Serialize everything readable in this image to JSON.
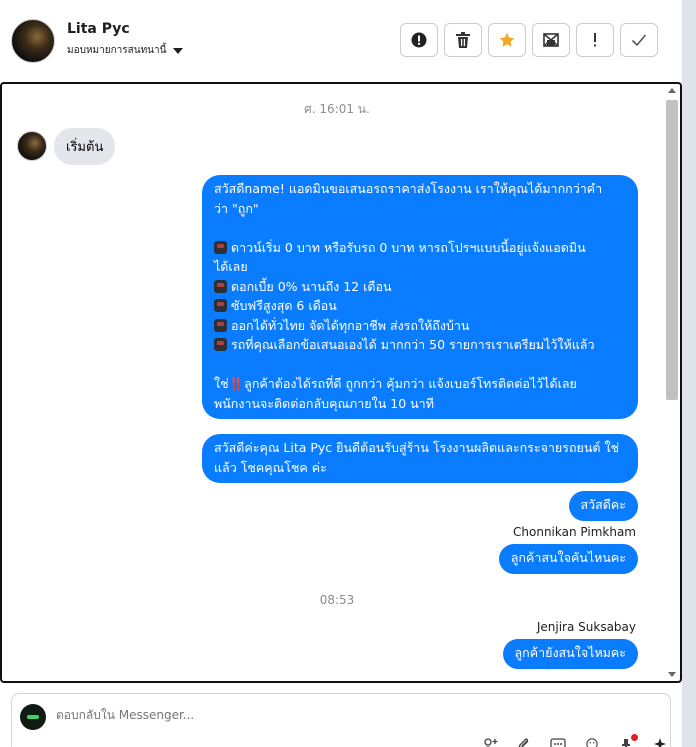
{
  "header": {
    "contact_name": "Lita Pyc",
    "assign_label": "มอบหมายการสนทนานี้",
    "actions": [
      {
        "name": "report-spam",
        "icon": "alert-circle-icon"
      },
      {
        "name": "delete",
        "icon": "trash-icon"
      },
      {
        "name": "star",
        "icon": "star-icon",
        "color": "#f5a623"
      },
      {
        "name": "mark-unread",
        "icon": "envelope-icon"
      },
      {
        "name": "follow-up",
        "icon": "exclamation-icon"
      },
      {
        "name": "done",
        "icon": "check-icon"
      }
    ]
  },
  "thread": {
    "timestamp_1": "ศ. 16:01 น.",
    "incoming_message": "เริ่มต้น",
    "main_message": {
      "line_1": "สวัสดีname! แอดมินขอเสนอรถราคาส่งโรงงาน เราให้คุณได้มากกว่าคำ",
      "line_2": "ว่า \"ถูก\"",
      "bullet_1a": "ดาวน์เริ่ม 0 บาท หรือรับรถ 0 บาท หารถโปรฯแบบนี้อยู่แจ้งแอดมิน",
      "bullet_1b": "ได้เลย",
      "bullet_2": "ดอกเบี้ย 0% นานถึง 12 เดือน",
      "bullet_3": "ซับฟรีสูงสุด 6 เดือน",
      "bullet_4": "ออกได้ทั่วไทย จัดได้ทุกอาชีพ ส่งรถให้ถึงบ้าน",
      "bullet_5": "รถที่คุณเลือกข้อเสนอเองได้ มากกว่า 50 รายการเราเตรียมไว้ให้แล้ว",
      "closing_prefix": "ใช่",
      "closing_bang": "‼️",
      "closing_1": "ลูกค้าต้องได้รถที่ดี ถูกกว่า คุ้มกว่า แจ้งเบอร์โทรติดต่อไว้ได้เลย",
      "closing_2": "พนักงานจะติดต่อกลับคุณภายใน 10 นาที"
    },
    "message_2": "สวัสดีค่ะคุณ Lita Pyc ยินดีต้อนรับสู่ร้าน โรงงานผลิตและกระจายรถยนต์ ใช่แล้ว โชคคุณโชค ค่ะ",
    "message_3": "สวัสดีคะ",
    "sender_1": "Chonnikan Pimkham",
    "message_4": "ลูกค้าสนใจคันไหนคะ",
    "timestamp_2": "08:53",
    "sender_2": "Jenjira Suksabay",
    "message_5": "ลูกค้ายังสนใจไหมคะ"
  },
  "composer": {
    "placeholder": "ตอบกลับใน Messenger...",
    "tools": [
      "add-person-icon",
      "paperclip-icon",
      "template-icon",
      "emoji-icon",
      "pin-icon",
      "sparkle-icon"
    ]
  },
  "colors": {
    "outgoing_bubble": "#0a7cff",
    "incoming_bubble": "#e4e6eb",
    "star": "#f5a623"
  }
}
